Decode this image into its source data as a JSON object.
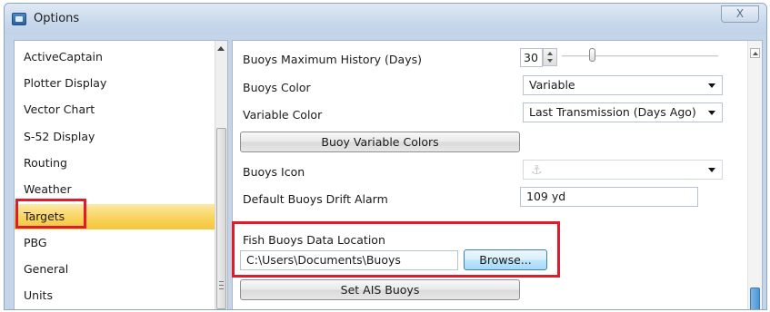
{
  "window": {
    "title": "Options",
    "close_label": "X"
  },
  "nav": {
    "items": [
      {
        "label": "ActiveCaptain"
      },
      {
        "label": "Plotter Display"
      },
      {
        "label": "Vector Chart"
      },
      {
        "label": "S-52 Display"
      },
      {
        "label": "Routing"
      },
      {
        "label": "Weather"
      },
      {
        "label": "Targets"
      },
      {
        "label": "PBG"
      },
      {
        "label": "General"
      },
      {
        "label": "Units"
      }
    ],
    "selected": "Targets"
  },
  "settings": {
    "max_history": {
      "label": "Buoys Maximum History (Days)",
      "value": "30"
    },
    "buoys_color": {
      "label": "Buoys Color",
      "value": "Variable"
    },
    "variable_color": {
      "label": "Variable Color",
      "value": "Last Transmission (Days Ago)"
    },
    "variable_colors_button": "Buoy Variable Colors",
    "buoys_icon": {
      "label": "Buoys Icon"
    },
    "drift_alarm": {
      "label": "Default Buoys Drift Alarm",
      "value": "109 yd"
    },
    "data_location": {
      "label": "Fish Buoys Data Location",
      "value": "C:\\Users\\Documents\\Buoys"
    },
    "browse_button": "Browse...",
    "set_ais_button": "Set AIS Buoys"
  },
  "colors": {
    "highlight_red": "#e11b2b",
    "selected_item_yellow": "#f9d35e",
    "window_blue": "#c4d5e9"
  },
  "icons": {
    "app": "options-window-icon",
    "buoy": "anchor-icon",
    "close": "close-icon"
  }
}
